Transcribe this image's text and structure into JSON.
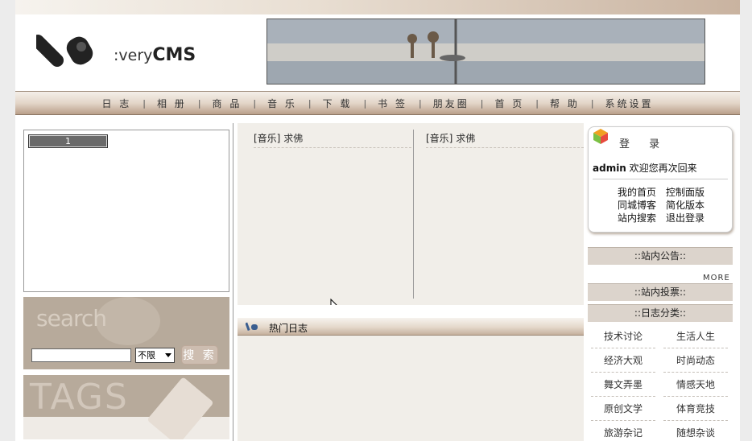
{
  "header": {
    "logo_prefix": ":very",
    "logo_suffix": "CMS"
  },
  "nav": {
    "items": [
      "日 志",
      "相 册",
      "商 品",
      "音 乐",
      "下 载",
      "书 签",
      "朋友圈",
      "首 页",
      "帮 助",
      "系统设置"
    ],
    "separator": "|"
  },
  "left": {
    "slider": {
      "page": "1"
    },
    "search": {
      "watermark": "search",
      "select_value": "不限",
      "button_label": "搜 索",
      "input_value": ""
    },
    "tags": {
      "watermark": "TAGS"
    }
  },
  "center": {
    "music_col1": [
      {
        "tag": "[音乐]",
        "title": "求佛"
      }
    ],
    "music_col2": [
      {
        "tag": "[音乐]",
        "title": "求佛"
      }
    ],
    "hot_title": "热门日志"
  },
  "right": {
    "login": {
      "title": "登 录",
      "username": "admin",
      "welcome": " 欢迎您再次回来",
      "links": [
        "我的首页",
        "控制面版",
        "同城博客",
        "简化版本",
        "站内搜索",
        "退出登录"
      ]
    },
    "announce_title": "::站内公告::",
    "more": "MORE",
    "vote_title": "::站内投票::",
    "category_title": "::日志分类::",
    "categories": [
      [
        "技术讨论",
        "生活人生"
      ],
      [
        "经济大观",
        "时尚动态"
      ],
      [
        "舞文弄墨",
        "情感天地"
      ],
      [
        "原创文学",
        "体育竞技"
      ],
      [
        "旅游杂记",
        "随想杂谈"
      ]
    ]
  },
  "colors": {
    "accent_brown": "#b7aa9b",
    "nav_gradient_end": "#b99f8a",
    "panel_bg": "#f1eee9"
  }
}
